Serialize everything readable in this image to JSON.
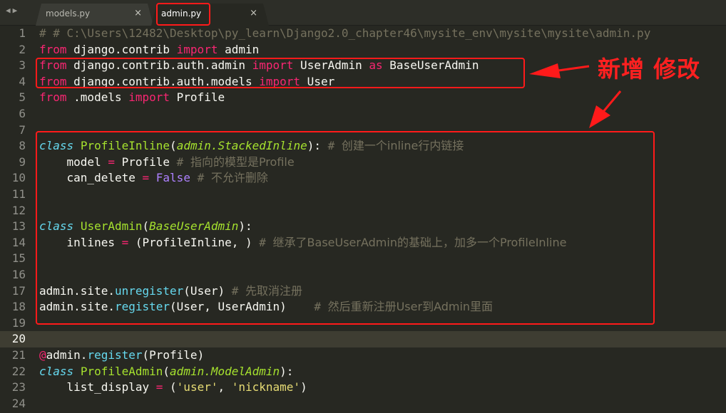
{
  "tabs": {
    "nav_left": "◀",
    "nav_right": "▶",
    "items": [
      {
        "label": "models.py",
        "close": "×"
      },
      {
        "label": "admin.py",
        "close": "×"
      }
    ]
  },
  "lines": [
    {
      "n": "1",
      "tokens": [
        {
          "t": "cm",
          "v": "# # C:\\Users\\12482\\Desktop\\py_learn\\Django2.0_chapter46\\mysite_env\\mysite\\mysite\\admin.py"
        }
      ]
    },
    {
      "n": "2",
      "tokens": [
        {
          "t": "kw",
          "v": "from"
        },
        {
          "t": "",
          "v": " django.contrib "
        },
        {
          "t": "kw",
          "v": "import"
        },
        {
          "t": "",
          "v": " admin"
        }
      ]
    },
    {
      "n": "3",
      "tokens": [
        {
          "t": "kw",
          "v": "from"
        },
        {
          "t": "",
          "v": " django.contrib.auth.admin "
        },
        {
          "t": "kw",
          "v": "import"
        },
        {
          "t": "",
          "v": " UserAdmin "
        },
        {
          "t": "kw",
          "v": "as"
        },
        {
          "t": "",
          "v": " BaseUserAdmin"
        }
      ]
    },
    {
      "n": "4",
      "tokens": [
        {
          "t": "kw",
          "v": "from"
        },
        {
          "t": "",
          "v": " django.contrib.auth.models "
        },
        {
          "t": "kw",
          "v": "import"
        },
        {
          "t": "",
          "v": " User"
        }
      ]
    },
    {
      "n": "5",
      "tokens": [
        {
          "t": "kw",
          "v": "from"
        },
        {
          "t": "",
          "v": " .models "
        },
        {
          "t": "kw",
          "v": "import"
        },
        {
          "t": "",
          "v": " Profile"
        }
      ]
    },
    {
      "n": "6",
      "tokens": []
    },
    {
      "n": "7",
      "tokens": []
    },
    {
      "n": "8",
      "tokens": [
        {
          "t": "st",
          "v": "class"
        },
        {
          "t": "",
          "v": " "
        },
        {
          "t": "cls",
          "v": "ProfileInline"
        },
        {
          "t": "",
          "v": "("
        },
        {
          "t": "inh",
          "v": "admin.StackedInline"
        },
        {
          "t": "",
          "v": "): "
        },
        {
          "t": "cm",
          "v": "# "
        },
        {
          "t": "cm cjk",
          "v": "创建一个inline行内链接"
        }
      ]
    },
    {
      "n": "9",
      "tokens": [
        {
          "t": "",
          "v": "    model "
        },
        {
          "t": "op",
          "v": "="
        },
        {
          "t": "",
          "v": " Profile "
        },
        {
          "t": "cm",
          "v": "# "
        },
        {
          "t": "cm cjk",
          "v": "指向的模型是Profile"
        }
      ]
    },
    {
      "n": "10",
      "tokens": [
        {
          "t": "",
          "v": "    can_delete "
        },
        {
          "t": "op",
          "v": "="
        },
        {
          "t": "",
          "v": " "
        },
        {
          "t": "bool",
          "v": "False"
        },
        {
          "t": "",
          "v": " "
        },
        {
          "t": "cm",
          "v": "# "
        },
        {
          "t": "cm cjk",
          "v": "不允许删除"
        }
      ]
    },
    {
      "n": "11",
      "tokens": []
    },
    {
      "n": "12",
      "tokens": []
    },
    {
      "n": "13",
      "tokens": [
        {
          "t": "st",
          "v": "class"
        },
        {
          "t": "",
          "v": " "
        },
        {
          "t": "cls",
          "v": "UserAdmin"
        },
        {
          "t": "",
          "v": "("
        },
        {
          "t": "inh",
          "v": "BaseUserAdmin"
        },
        {
          "t": "",
          "v": "):"
        }
      ]
    },
    {
      "n": "14",
      "tokens": [
        {
          "t": "",
          "v": "    inlines "
        },
        {
          "t": "op",
          "v": "="
        },
        {
          "t": "",
          "v": " (ProfileInline, ) "
        },
        {
          "t": "cm",
          "v": "# "
        },
        {
          "t": "cm cjk",
          "v": "继承了BaseUserAdmin的基础上，加多一个ProfileInline"
        }
      ]
    },
    {
      "n": "15",
      "tokens": []
    },
    {
      "n": "16",
      "tokens": []
    },
    {
      "n": "17",
      "tokens": [
        {
          "t": "",
          "v": "admin.site."
        },
        {
          "t": "fn",
          "v": "unregister"
        },
        {
          "t": "",
          "v": "(User) "
        },
        {
          "t": "cm",
          "v": "# "
        },
        {
          "t": "cm cjk",
          "v": "先取消注册"
        }
      ]
    },
    {
      "n": "18",
      "tokens": [
        {
          "t": "",
          "v": "admin.site."
        },
        {
          "t": "fn",
          "v": "register"
        },
        {
          "t": "",
          "v": "(User, UserAdmin)    "
        },
        {
          "t": "cm",
          "v": "# "
        },
        {
          "t": "cm cjk",
          "v": "然后重新注册User到Admin里面"
        }
      ]
    },
    {
      "n": "19",
      "tokens": []
    },
    {
      "n": "20",
      "tokens": [],
      "current": true
    },
    {
      "n": "21",
      "tokens": [
        {
          "t": "dec",
          "v": "@"
        },
        {
          "t": "",
          "v": "admin."
        },
        {
          "t": "fn",
          "v": "register"
        },
        {
          "t": "",
          "v": "(Profile)"
        }
      ]
    },
    {
      "n": "22",
      "tokens": [
        {
          "t": "st",
          "v": "class"
        },
        {
          "t": "",
          "v": " "
        },
        {
          "t": "cls",
          "v": "ProfileAdmin"
        },
        {
          "t": "",
          "v": "("
        },
        {
          "t": "inh",
          "v": "admin.ModelAdmin"
        },
        {
          "t": "",
          "v": "):"
        }
      ]
    },
    {
      "n": "23",
      "tokens": [
        {
          "t": "",
          "v": "    list_display "
        },
        {
          "t": "op",
          "v": "="
        },
        {
          "t": "",
          "v": " ("
        },
        {
          "t": "str",
          "v": "'user'"
        },
        {
          "t": "",
          "v": ", "
        },
        {
          "t": "str",
          "v": "'nickname'"
        },
        {
          "t": "",
          "v": ")"
        }
      ]
    },
    {
      "n": "24",
      "tokens": []
    }
  ],
  "annotation": {
    "label": "新增 修改",
    "color": "#ff1a1a"
  }
}
